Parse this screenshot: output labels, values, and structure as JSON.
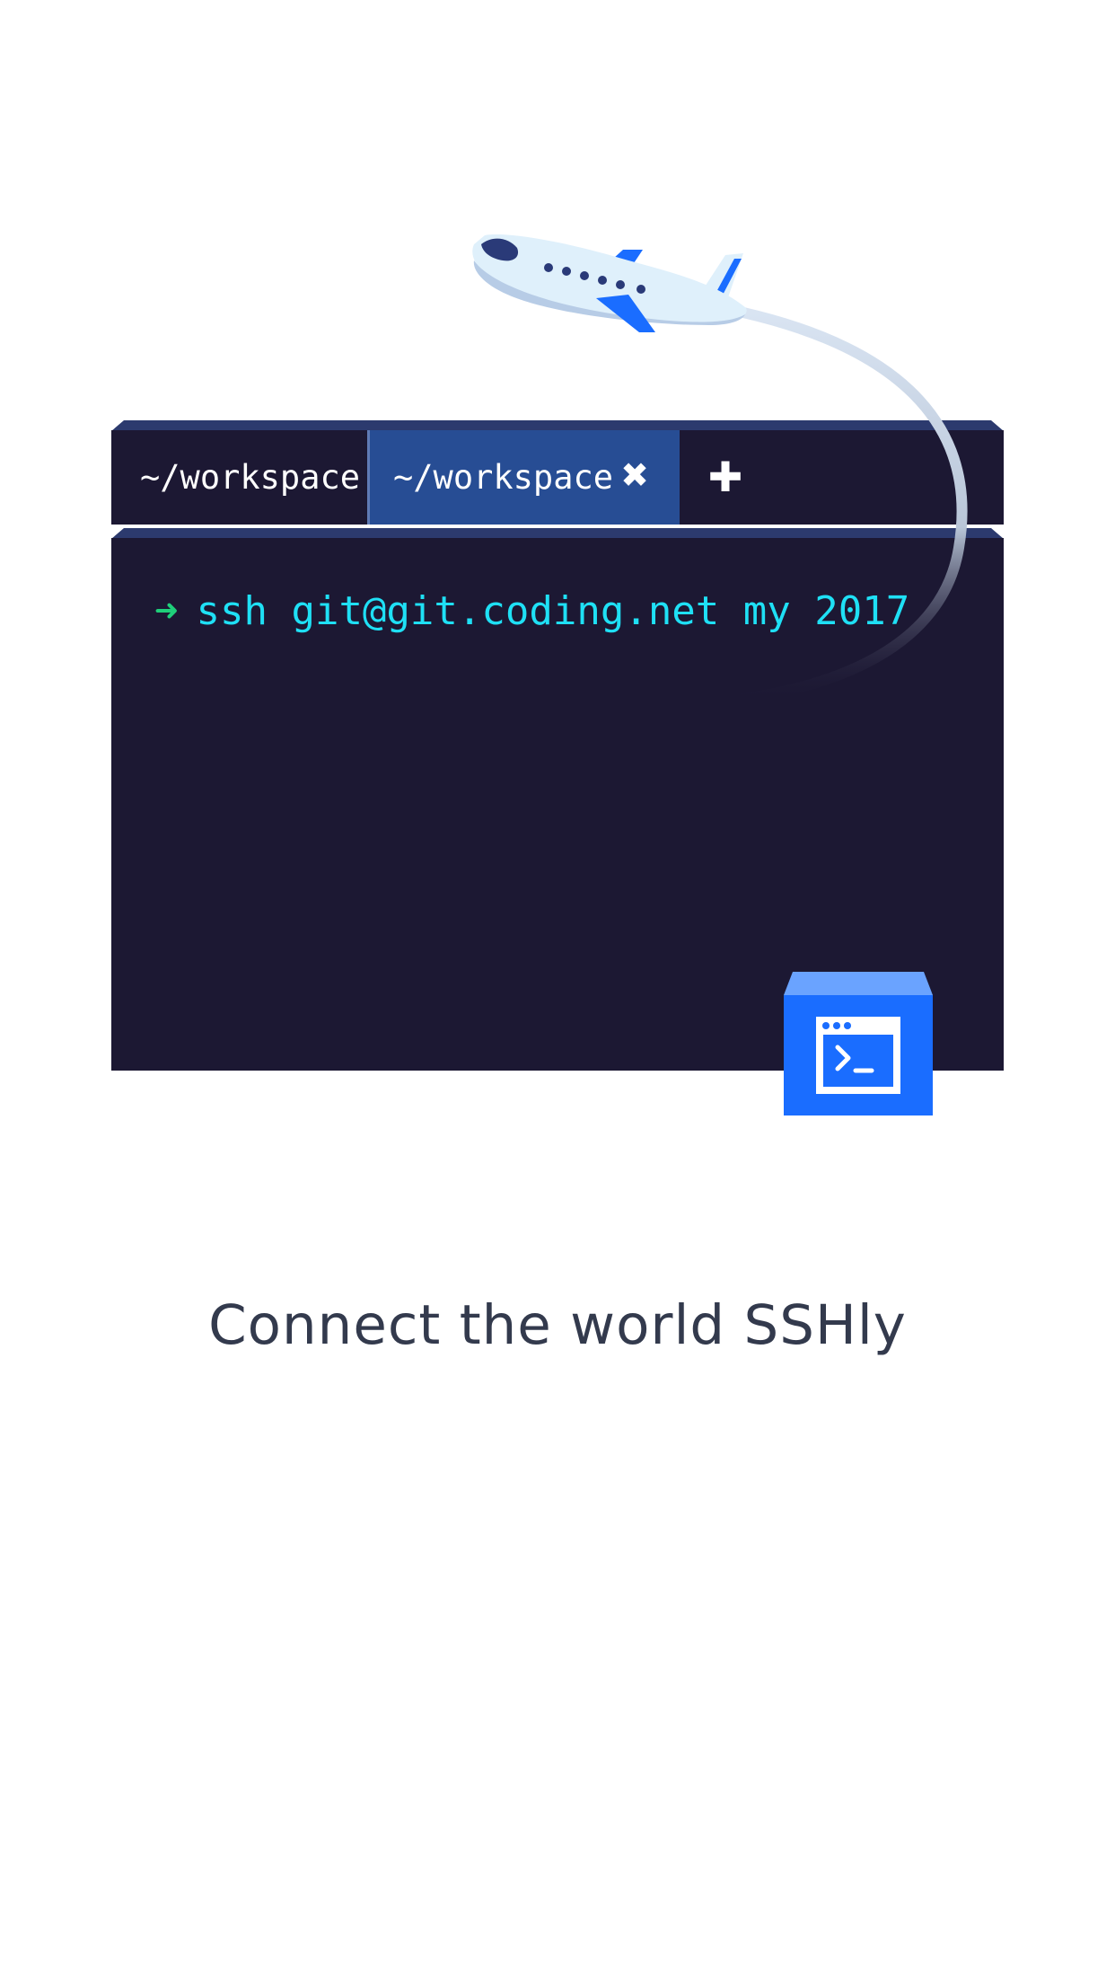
{
  "terminal": {
    "tabs": [
      {
        "label": "~/workspace",
        "active": false
      },
      {
        "label": "~/workspace",
        "active": true
      }
    ],
    "close_glyph": "✖",
    "add_glyph": "✚",
    "prompt_symbol": "➜",
    "command": "ssh git@git.coding.net my 2017"
  },
  "tagline": "Connect the world SSHly",
  "icons": {
    "plane": "airplane-icon",
    "app": "terminal-app-icon"
  },
  "colors": {
    "terminal_bg": "#1c1833",
    "active_tab": "#274d94",
    "prompt_arrow": "#1fcf7a",
    "command_text": "#1fe0f5",
    "accent_blue": "#1a6dff",
    "tagline_text": "#333a4d"
  }
}
